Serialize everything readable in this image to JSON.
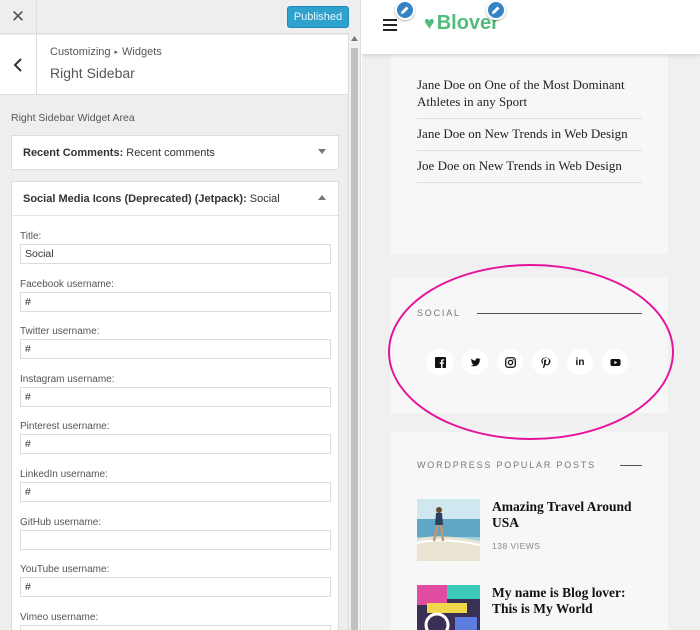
{
  "customizer": {
    "close_icon": "close-icon",
    "publish_label": "Published",
    "breadcrumb": {
      "root": "Customizing",
      "separator": "▸",
      "current": "Widgets"
    },
    "section_title": "Right Sidebar",
    "area_label": "Right Sidebar Widget Area",
    "widgets": [
      {
        "title_bold": "Recent Comments:",
        "title_rest": "Recent comments"
      },
      {
        "title_bold": "Social Media Icons (Deprecated) (Jetpack):",
        "title_rest": "Social"
      }
    ],
    "fields": [
      {
        "label": "Title:",
        "value": "Social"
      },
      {
        "label": "Facebook username:",
        "value": "#"
      },
      {
        "label": "Twitter username:",
        "value": "#"
      },
      {
        "label": "Instagram username:",
        "value": "#"
      },
      {
        "label": "Pinterest username:",
        "value": "#"
      },
      {
        "label": "LinkedIn username:",
        "value": "#"
      },
      {
        "label": "GitHub username:",
        "value": ""
      },
      {
        "label": "YouTube username:",
        "value": "#"
      },
      {
        "label": "Vimeo username:",
        "value": ""
      }
    ]
  },
  "preview": {
    "logo_text": "Blover",
    "brand_color": "#4fbc7c",
    "recent_comments": [
      "Jane Doe on One of the Most Dominant Athletes in any Sport",
      "Jane Doe on New Trends in Web Design",
      "Joe Doe on New Trends in Web Design"
    ],
    "social": {
      "heading": "SOCIAL",
      "icons": [
        "facebook-icon",
        "twitter-icon",
        "instagram-icon",
        "pinterest-icon",
        "linkedin-icon",
        "youtube-icon"
      ],
      "linkedin_text": "in"
    },
    "popular_posts": {
      "heading": "WORDPRESS POPULAR POSTS",
      "posts": [
        {
          "title": "Amazing Travel Around USA",
          "views": "138 VIEWS"
        },
        {
          "title": "My name is Blog lover: This is My World",
          "views": ""
        }
      ]
    },
    "highlight_color": "#e6139d"
  }
}
